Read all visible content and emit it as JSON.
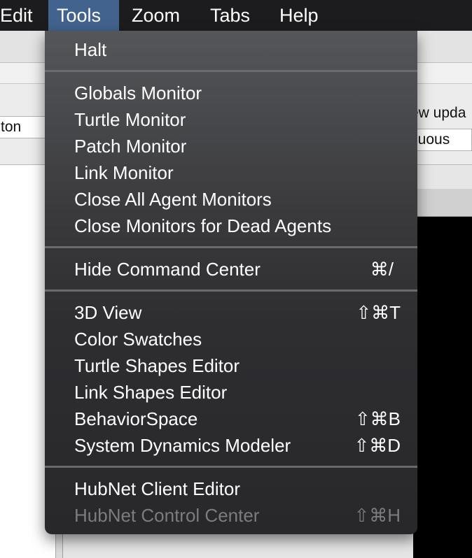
{
  "menubar": {
    "items": [
      {
        "label": "Edit"
      },
      {
        "label": "Tools"
      },
      {
        "label": "Zoom"
      },
      {
        "label": "Tabs"
      },
      {
        "label": "Help"
      }
    ],
    "active": "Tools"
  },
  "background": {
    "left_field": "ton",
    "right_label": "ew upda",
    "right_select": "nuous"
  },
  "tools_menu": {
    "groups": [
      [
        {
          "label": "Halt",
          "shortcut": ""
        }
      ],
      [
        {
          "label": "Globals Monitor",
          "shortcut": ""
        },
        {
          "label": "Turtle Monitor",
          "shortcut": ""
        },
        {
          "label": "Patch Monitor",
          "shortcut": ""
        },
        {
          "label": "Link Monitor",
          "shortcut": ""
        },
        {
          "label": "Close All Agent Monitors",
          "shortcut": ""
        },
        {
          "label": "Close Monitors for Dead Agents",
          "shortcut": ""
        }
      ],
      [
        {
          "label": "Hide Command Center",
          "shortcut": "⌘/"
        }
      ],
      [
        {
          "label": "3D View",
          "shortcut": "⇧⌘T"
        },
        {
          "label": "Color Swatches",
          "shortcut": ""
        },
        {
          "label": "Turtle Shapes Editor",
          "shortcut": ""
        },
        {
          "label": "Link Shapes Editor",
          "shortcut": ""
        },
        {
          "label": "BehaviorSpace",
          "shortcut": "⇧⌘B"
        },
        {
          "label": "System Dynamics Modeler",
          "shortcut": "⇧⌘D"
        }
      ],
      [
        {
          "label": "HubNet Client Editor",
          "shortcut": ""
        },
        {
          "label": "HubNet Control Center",
          "shortcut": "⇧⌘H",
          "disabled": true
        }
      ]
    ]
  }
}
